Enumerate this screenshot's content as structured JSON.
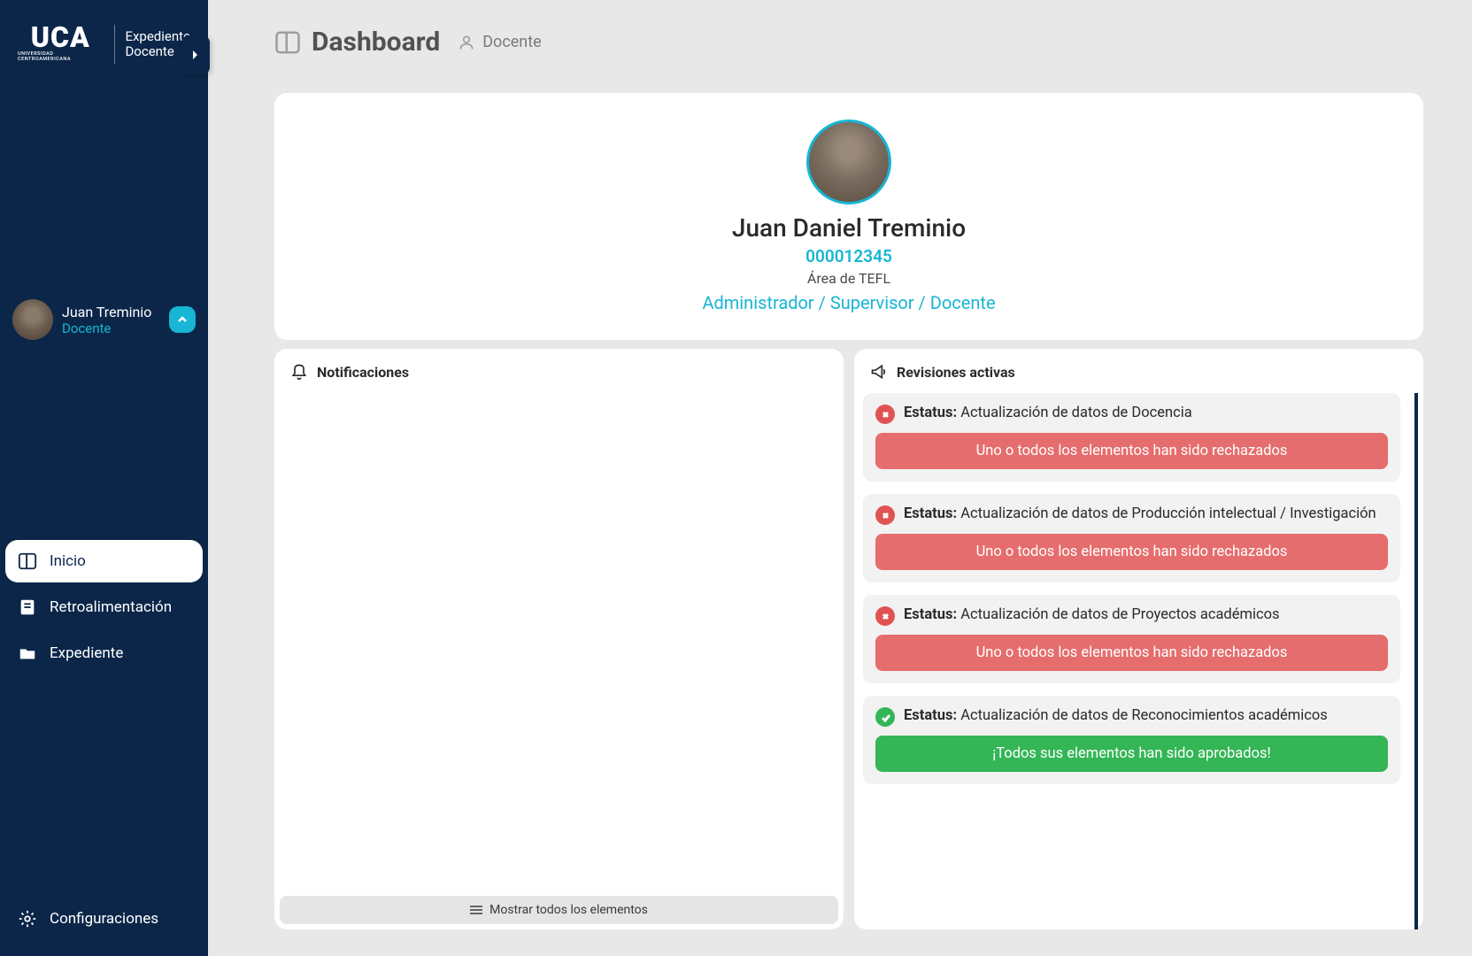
{
  "brand": {
    "uca": "UCA",
    "uca_sub": "UNIVERSIDAD CENTROAMERICANA",
    "app_line1": "Expediente",
    "app_line2": "Docente"
  },
  "sidebar_user": {
    "name": "Juan Treminio",
    "role": "Docente"
  },
  "nav": {
    "home": "Inicio",
    "feedback": "Retroalimentación",
    "expediente": "Expediente",
    "settings": "Configuraciones"
  },
  "header": {
    "title": "Dashboard",
    "subtitle": "Docente"
  },
  "profile": {
    "name": "Juan Daniel Treminio",
    "id": "000012345",
    "area": "Área de TEFL",
    "roles": "Administrador / Supervisor / Docente"
  },
  "panels": {
    "notifications_title": "Notificaciones",
    "revisions_title": "Revisiones activas",
    "show_all": "Mostrar todos los elementos"
  },
  "status_label": "Estatus:",
  "msg_rejected": "Uno o todos los elementos han sido rechazados",
  "msg_approved": "¡Todos sus elementos han sido aprobados!",
  "revisions": [
    {
      "status": "reject",
      "text": "Actualización de datos de Docencia"
    },
    {
      "status": "reject",
      "text": "Actualización de datos de Producción intelectual / Investigación"
    },
    {
      "status": "reject",
      "text": "Actualización de datos de Proyectos académicos"
    },
    {
      "status": "approve",
      "text": "Actualización de datos de Reconocimientos académicos"
    }
  ]
}
